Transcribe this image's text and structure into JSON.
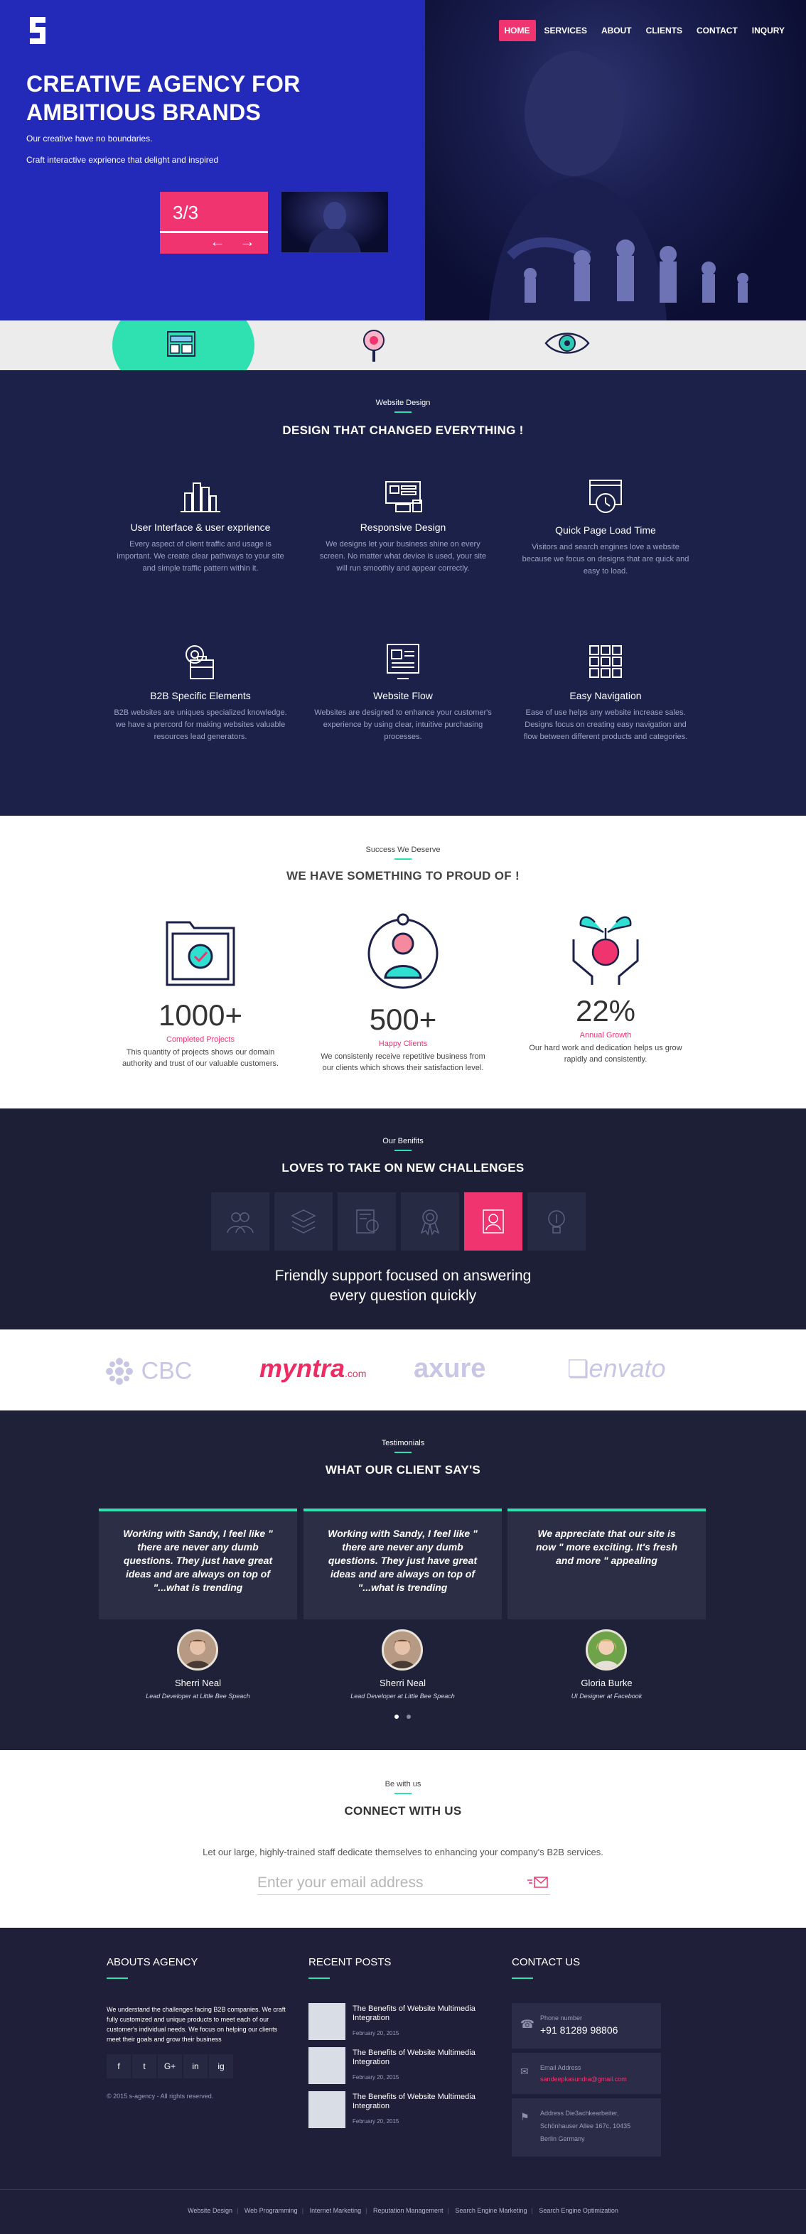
{
  "nav": {
    "items": [
      "HOME",
      "SERVICES",
      "ABOUT",
      "CLIENTS",
      "CONTACT",
      "INQURY"
    ],
    "active": "HOME"
  },
  "hero": {
    "title": "CREATIVE AGENCY FOR AMBITIOUS BRANDS",
    "subtitle": "Our creative have no boundaries.",
    "subtitle2": "Craft interactive exprience that delight and inspired",
    "slide_counter": "3/3",
    "prev_icon": "arrow-left-icon",
    "next_icon": "arrow-right-icon"
  },
  "strip": {
    "icons": [
      "website-layout-icon",
      "magnifier-gear-icon",
      "eye-icon"
    ]
  },
  "design": {
    "kicker": "Website Design",
    "heading": "DESIGN THAT CHANGED EVERYTHING !",
    "features": [
      {
        "icon": "city-buildings-icon",
        "title": "User Interface & user exprience",
        "text": "Every aspect of client traffic and usage is important. We create clear pathways to your site and simple traffic pattern within it."
      },
      {
        "icon": "devices-icon",
        "title": "Responsive Design",
        "text": "We designs let your business shine on every screen. No matter what device is used, your site will run smoothly and appear correctly."
      },
      {
        "icon": "stopwatch-browser-icon",
        "title": "Quick Page Load Time",
        "text": "Visitors and search engines love a website because we focus on designs that are quick and easy to load."
      },
      {
        "icon": "gear-briefcase-icon",
        "title": "B2B Specific Elements",
        "text": "B2B websites are uniques specialized knowledge. we have a prercord for making websites valuable resources lead generators."
      },
      {
        "icon": "web-document-icon",
        "title": "Website Flow",
        "text": "Websites are designed to enhance your customer's experience by using clear, intuitive purchasing processes."
      },
      {
        "icon": "grid-icon",
        "title": "Easy Navigation",
        "text": "Ease of use helps any website increase sales. Designs focus on creating easy navigation and flow between different products and categories."
      }
    ]
  },
  "stats": {
    "kicker": "Success We Deserve",
    "heading": "WE HAVE SOMETHING TO PROUD OF !",
    "items": [
      {
        "icon": "folder-check-icon",
        "value": "1000+",
        "label": "Completed Projects",
        "text": "This quantity of projects shows our domain authority and trust of our valuable customers."
      },
      {
        "icon": "client-cycle-icon",
        "value": "500+",
        "label": "Happy Clients",
        "text": "We consistenly receive repetitive business from our clients which shows their satisfaction level."
      },
      {
        "icon": "growth-plant-icon",
        "value": "22%",
        "label": "Annual Growth",
        "text": "Our hard work and dedication helps us grow rapidly and consistently."
      }
    ]
  },
  "benefits": {
    "kicker": "Our Benifits",
    "heading": "LOVES TO TAKE ON NEW CHALLENGES",
    "tiles": [
      "users-icon",
      "layers-icon",
      "document-gear-icon",
      "award-icon",
      "support-agent-icon",
      "lightbulb-icon"
    ],
    "active_index": 4,
    "text_line1": "Friendly support focused on answering",
    "text_line2": "every question quickly"
  },
  "brands": {
    "items": [
      "CBC",
      "myntra",
      ".com",
      "axure",
      "envato"
    ]
  },
  "testimonials": {
    "kicker": "Testimonials",
    "heading": "WHAT OUR CLIENT SAY'S",
    "items": [
      {
        "quote": "Working with Sandy, I feel like \" there are never any dumb questions. They just have great ideas and are always on top of \"...what is trending",
        "name": "Sherri Neal",
        "role": "Lead Developer at Little Bee Speach"
      },
      {
        "quote": "Working with Sandy, I feel like \" there are never any dumb questions. They just have great ideas and are always on top of \"...what is trending",
        "name": "Sherri Neal",
        "role": "Lead Developer at Little Bee Speach"
      },
      {
        "quote": "We appreciate that our site is now \" more exciting. It's fresh and more \" appealing",
        "name": "Gloria Burke",
        "role": "UI Designer at Facebook"
      }
    ]
  },
  "connect": {
    "kicker": "Be with us",
    "heading": "CONNECT WITH US",
    "text": "Let our large, highly-trained staff dedicate themselves to enhancing your company's B2B services.",
    "email_placeholder": "Enter your email address",
    "send_icon": "send-mail-icon"
  },
  "footer": {
    "about_title": "ABOUTS AGENCY",
    "about_text": "We understand the challenges facing B2B companies. We craft fully customized and unique products to meet each of our customer's individual needs. We focus on helping our clients meet their goals and grow their business",
    "social": [
      "f",
      "t",
      "G+",
      "in",
      "ig"
    ],
    "copyright": "© 2015 s-agency - All rights reserved.",
    "posts_title": "RECENT POSTS",
    "posts": [
      {
        "title": "The Benefits of Website Multimedia Integration",
        "date": "February 20, 2015"
      },
      {
        "title": "The Benefits of Website Multimedia Integration",
        "date": "February 20, 2015"
      },
      {
        "title": "The Benefits of Website Multimedia Integration",
        "date": "February 20, 2015"
      }
    ],
    "contact_title": "CONTACT US",
    "phone_label": "Phone number",
    "phone": "+91 81289 98806",
    "email_label": "Email Address",
    "email": "sandeepkasundra@gmail.com",
    "address_label": "Address Die3achkearbeiter,",
    "address_line2": "Schönhauser Allee 167c, 10435",
    "address_line3": "Berlin Germany"
  },
  "bottom_links": [
    "Website Design",
    "Web Programming",
    "Internet Marketing",
    "Reputation Management",
    "Search Engine Marketing",
    "Search Engine Optimization"
  ],
  "colors": {
    "accent": "#f0346f",
    "teal": "#2fe0b0",
    "hero_blue": "#2329b8",
    "navy": "#1c2149"
  }
}
